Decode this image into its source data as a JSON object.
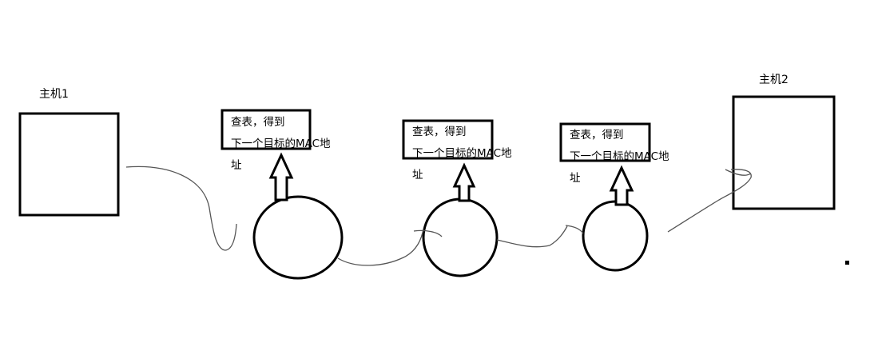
{
  "hosts": [
    {
      "label": "主机1"
    },
    {
      "label": "主机2"
    }
  ],
  "routers": [
    {
      "note_line1": "查表，得到",
      "note_line2": "下一个目标的MAC地",
      "note_line3": "址"
    },
    {
      "note_line1": "查表，得到",
      "note_line2": "下一个目标的MAC地",
      "note_line3": "址"
    },
    {
      "note_line1": "查表，得到",
      "note_line2": "下一个目标的MAC地",
      "note_line3": "址"
    }
  ],
  "colors": {
    "stroke": "#000000",
    "link": "#555555",
    "background": "#ffffff"
  }
}
